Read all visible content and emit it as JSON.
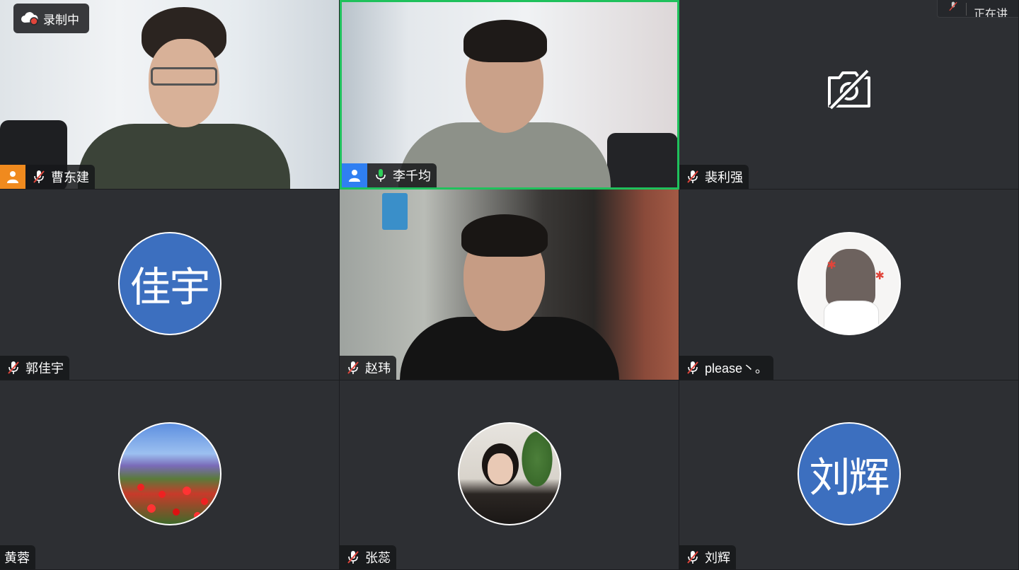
{
  "recording": {
    "label": "录制中"
  },
  "speaking_indicator": {
    "label": "正在讲"
  },
  "participants": [
    {
      "name": "曹东建",
      "mic": "muted",
      "video": "on",
      "role": "host"
    },
    {
      "name": "李千均",
      "mic": "active",
      "video": "on",
      "role": "cohost",
      "active_speaker": true
    },
    {
      "name": "裴利强",
      "mic": "muted",
      "video": "off"
    },
    {
      "name": "郭佳宇",
      "mic": "muted",
      "video": "off",
      "avatar_text": "佳宇"
    },
    {
      "name": "赵玮",
      "mic": "muted",
      "video": "on"
    },
    {
      "name": "please丶。",
      "mic": "muted",
      "video": "off",
      "avatar": "anime-girl"
    },
    {
      "name": "黄蓉",
      "video": "off",
      "avatar": "flower-field"
    },
    {
      "name": "张蕊",
      "mic": "muted",
      "video": "off",
      "avatar": "photo"
    },
    {
      "name": "刘辉",
      "mic": "muted",
      "video": "off",
      "avatar_text": "刘辉"
    }
  ],
  "colors": {
    "active_speaker_border": "#1fc15c",
    "host_badge": "#f08a1e",
    "cohost_badge": "#2f7ff2",
    "avatar_bg": "#3c6fbf",
    "tile_bg": "#2d2f33",
    "mic_muted": "#e0453b",
    "mic_active": "#2fd05a"
  },
  "icons": {
    "muted_mic": "mic-muted-icon",
    "active_mic": "mic-active-icon",
    "camera_off": "camera-off-icon",
    "recording": "cloud-record-icon",
    "host": "person-icon"
  }
}
